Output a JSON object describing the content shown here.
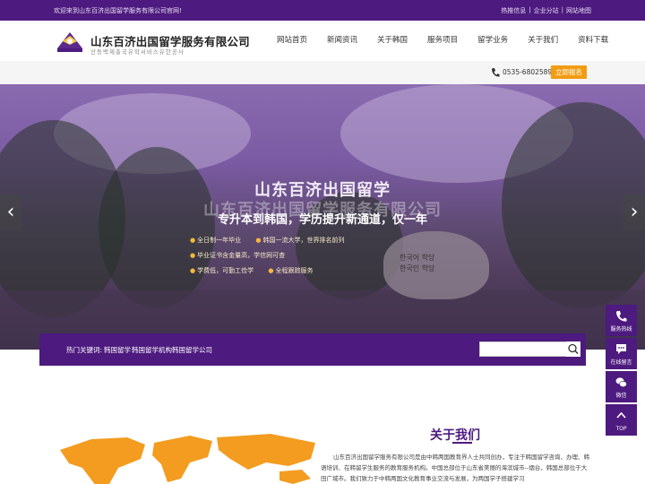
{
  "topbar": {
    "welcome": "欢迎来到山东百济出国留学服务有限公司官网!",
    "links": [
      "热推信息",
      "|",
      "企业分站",
      "|",
      "网站地图"
    ]
  },
  "header": {
    "brand_cn": "山东百济出国留学服务有限公司",
    "brand_kr": "산동백제출국유학서비스유한공사"
  },
  "nav": {
    "items": [
      "网站首页",
      "新闻资讯",
      "关于韩国",
      "服务项目",
      "留学业务",
      "关于我们",
      "资料下载"
    ]
  },
  "subbar": {
    "phone": "0535-6802589",
    "signup": "立即报名"
  },
  "banner": {
    "title": "山东百济出国留学",
    "ghost": "山东百济出国留学服务有限公司",
    "subtitle": "专升本到韩国，学历提升新通道，仅一年",
    "features": [
      "全日制一年毕业",
      "韩国一流大学，世界排名前列",
      "毕业证书含金量高，学信网可查",
      "学费低，可勤工俭学",
      "全程跟踪服务"
    ],
    "stone_text": [
      "한국어 학당",
      "한국인 학당"
    ],
    "prev": "‹",
    "next": "›"
  },
  "keywords": {
    "label": "热门关键词:",
    "items": [
      "韩国留学",
      "韩国留学机构",
      "韩国留学公司"
    ],
    "search_placeholder": ""
  },
  "about": {
    "title": "关于我们",
    "text": "山东百济出国留学服务有限公司是由中韩两国教育界人士共同创办，专注于韩国留学咨询、办理、韩语培训、在韩留学生服务的教育服务机构。中国总部位于山东省美丽的海滨城市--烟台，韩国总部位于大田广域市。我们致力于中韩两国文化教育事业交流与发展，为两国学子搭建学习"
  },
  "float": {
    "items": [
      "服务热线",
      "在线留言",
      "微信",
      "TOP"
    ]
  },
  "colors": {
    "brand_purple": "#4d1a7f",
    "accent_orange": "#f39c12"
  }
}
